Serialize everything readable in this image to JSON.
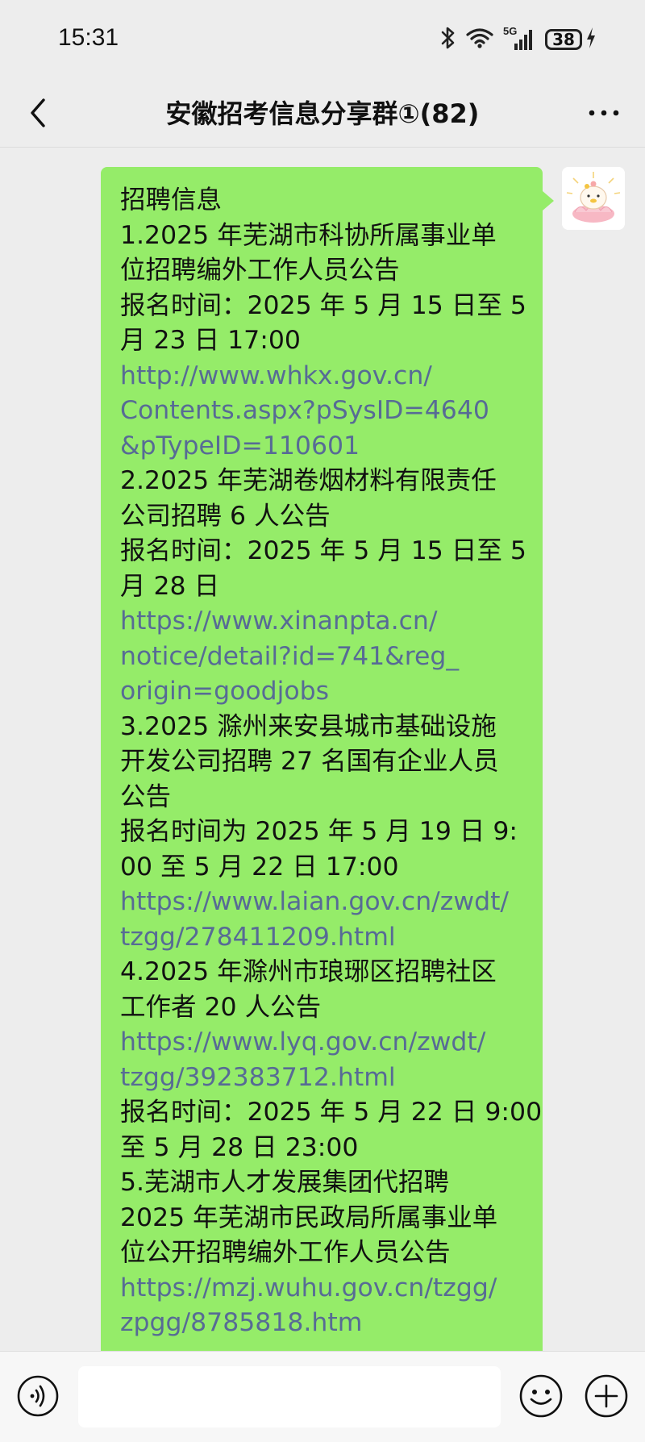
{
  "status_bar": {
    "time": "15:31",
    "signal_label": "5G",
    "battery": "38"
  },
  "nav": {
    "title": "安徽招考信息分享群①(82)"
  },
  "message": {
    "lines": [
      {
        "text": "招聘信息",
        "link": false
      },
      {
        "text": "1.2025 年芜湖市科协所属事业单",
        "link": false
      },
      {
        "text": "位招聘编外工作人员公告",
        "link": false
      },
      {
        "text": "报名时间：2025 年 5 月 15 日至 5",
        "link": false
      },
      {
        "text": "月 23 日 17:00",
        "link": false
      },
      {
        "text": "http://www.whkx.gov.cn/",
        "link": true
      },
      {
        "text": "Contents.aspx?pSysID=4640",
        "link": true
      },
      {
        "text": "&pTypeID=110601",
        "link": true
      },
      {
        "text": "2.2025 年芜湖卷烟材料有限责任",
        "link": false
      },
      {
        "text": "公司招聘 6 人公告",
        "link": false
      },
      {
        "text": "报名时间：2025 年 5 月 15 日至 5",
        "link": false
      },
      {
        "text": "月 28 日",
        "link": false
      },
      {
        "text": "https://www.xinanpta.cn/",
        "link": true
      },
      {
        "text": "notice/detail?id=741&reg_",
        "link": true
      },
      {
        "text": "origin=goodjobs",
        "link": true
      },
      {
        "text": "3.2025 滁州来安县城市基础设施",
        "link": false
      },
      {
        "text": "开发公司招聘 27 名国有企业人员",
        "link": false
      },
      {
        "text": "公告",
        "link": false
      },
      {
        "text": "报名时间为 2025 年 5 月 19 日 9:",
        "link": false
      },
      {
        "text": "00 至 5 月 22 日 17:00",
        "link": false
      },
      {
        "text": "https://www.laian.gov.cn/zwdt/",
        "link": true
      },
      {
        "text": "tzgg/278411209.html",
        "link": true
      },
      {
        "text": "4.2025 年滁州市琅琊区招聘社区",
        "link": false
      },
      {
        "text": "工作者 20 人公告",
        "link": false
      },
      {
        "text": "https://www.lyq.gov.cn/zwdt/",
        "link": true
      },
      {
        "text": "tzgg/392383712.html",
        "link": true
      },
      {
        "text": "报名时间：2025 年 5 月 22 日 9:00",
        "link": false
      },
      {
        "text": "至 5 月 28 日 23:00",
        "link": false
      },
      {
        "text": "5.芜湖市人才发展集团代招聘",
        "link": false
      },
      {
        "text": "2025 年芜湖市民政局所属事业单",
        "link": false
      },
      {
        "text": "位公开招聘编外工作人员公告",
        "link": false
      },
      {
        "text": "https://mzj.wuhu.gov.cn/tzgg/",
        "link": true
      },
      {
        "text": "zpgg/8785818.htm",
        "link": true
      }
    ]
  },
  "input": {
    "placeholder": ""
  },
  "colors": {
    "bubble": "#95ec69",
    "link": "#576b95",
    "background": "#ededed"
  },
  "icons": [
    "bluetooth-icon",
    "wifi-icon",
    "signal-icon",
    "battery-icon",
    "charging-icon",
    "back-icon",
    "more-icon",
    "voice-icon",
    "emoji-icon",
    "plus-icon",
    "avatar-image"
  ]
}
